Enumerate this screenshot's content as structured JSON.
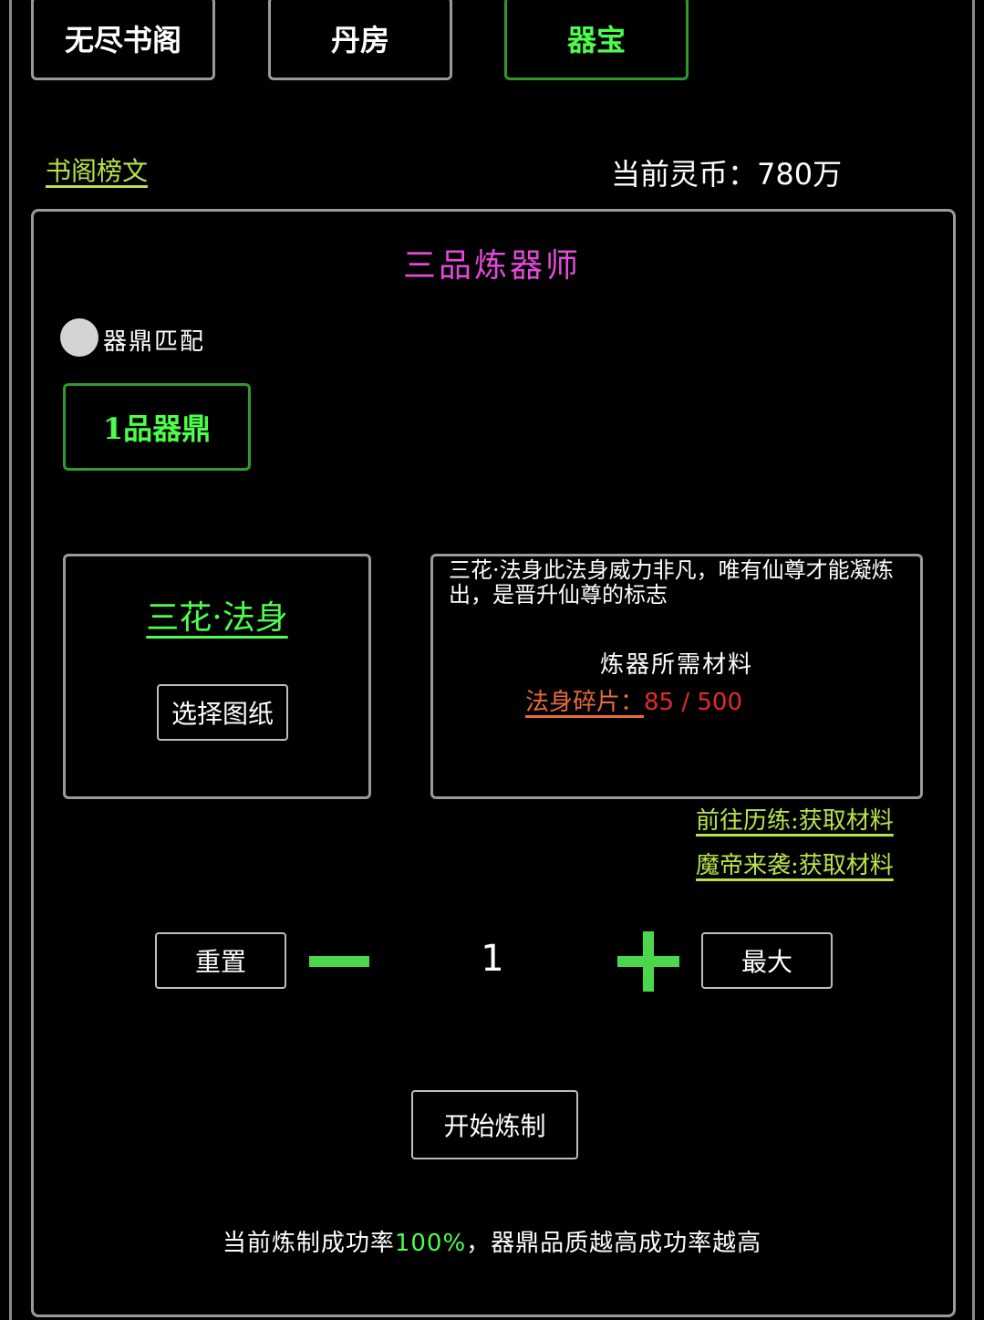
{
  "tabs": [
    {
      "label": "无尽书阁",
      "active": false
    },
    {
      "label": "丹房",
      "active": false
    },
    {
      "label": "器宝",
      "active": true
    }
  ],
  "notice_link": "书阁榜文",
  "currency": {
    "label": "当前灵币：",
    "value": "780万"
  },
  "rank_title": "三品炼器师",
  "match_toggle": {
    "label": "器鼎匹配",
    "on": false
  },
  "cauldron_button": "1品器鼎",
  "blueprint": {
    "name": "三花·法身",
    "select_button": "选择图纸"
  },
  "detail": {
    "description": "三花·法身此法身威力非凡，唯有仙尊才能凝炼出，是晋升仙尊的标志",
    "materials_title": "炼器所需材料",
    "material_name": "法身碎片：",
    "material_count": "85 / 500"
  },
  "acquire_links": [
    "前往历练:获取材料",
    "魔帝来袭:获取材料"
  ],
  "quantity": {
    "reset_label": "重置",
    "value": "1",
    "max_label": "最大"
  },
  "start_button": "开始炼制",
  "success_rate": {
    "prefix": "当前炼制成功率",
    "value": "100%",
    "suffix": "，器鼎品质越高成功率越高"
  },
  "colors": {
    "accent_green": "#4cff4c",
    "link_yellow_green": "#b7e34d",
    "rank_magenta": "#e24ad8",
    "material_orange": "#e96a3a",
    "count_red": "#e52b2b"
  }
}
